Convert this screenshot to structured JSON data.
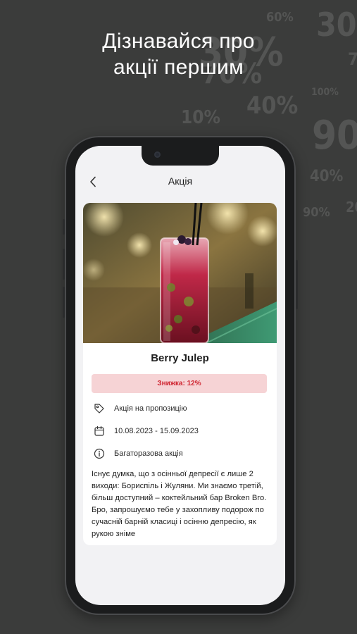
{
  "headline": {
    "line1": "Дізнавайся про",
    "line2": "акції першим"
  },
  "background_percents": [
    "60%",
    "30",
    "30%",
    "7",
    "100%",
    "10%",
    "40%",
    "90",
    "40%",
    "20",
    "90%",
    "70%"
  ],
  "nav": {
    "title": "Акція",
    "back_icon": "chevron-left-icon"
  },
  "promo": {
    "title": "Berry Julep",
    "discount": "Знижка: 12%",
    "details": [
      {
        "icon": "tag-icon",
        "text": "Акція на пропозицію"
      },
      {
        "icon": "calendar-icon",
        "text": "10.08.2023 - 15.09.2023"
      },
      {
        "icon": "info-icon",
        "text": "Багаторазова акція"
      }
    ],
    "description": "Існує думка, що з осінньої депресії є лише 2 виходи: Бориспіль і Жуляни. Ми знаємо третій, більш доступний – коктейльний бар Broken Bro.  Бро, запрошуємо тебе у захопливу подорож по сучасній барній класиці і осінню депресію, як рукою зніме"
  },
  "colors": {
    "background": "#3b3c3b",
    "discount_bg": "#f6d3d5",
    "discount_text": "#cf2430",
    "screen_bg": "#f2f2f4",
    "card_bg": "#ffffff"
  }
}
